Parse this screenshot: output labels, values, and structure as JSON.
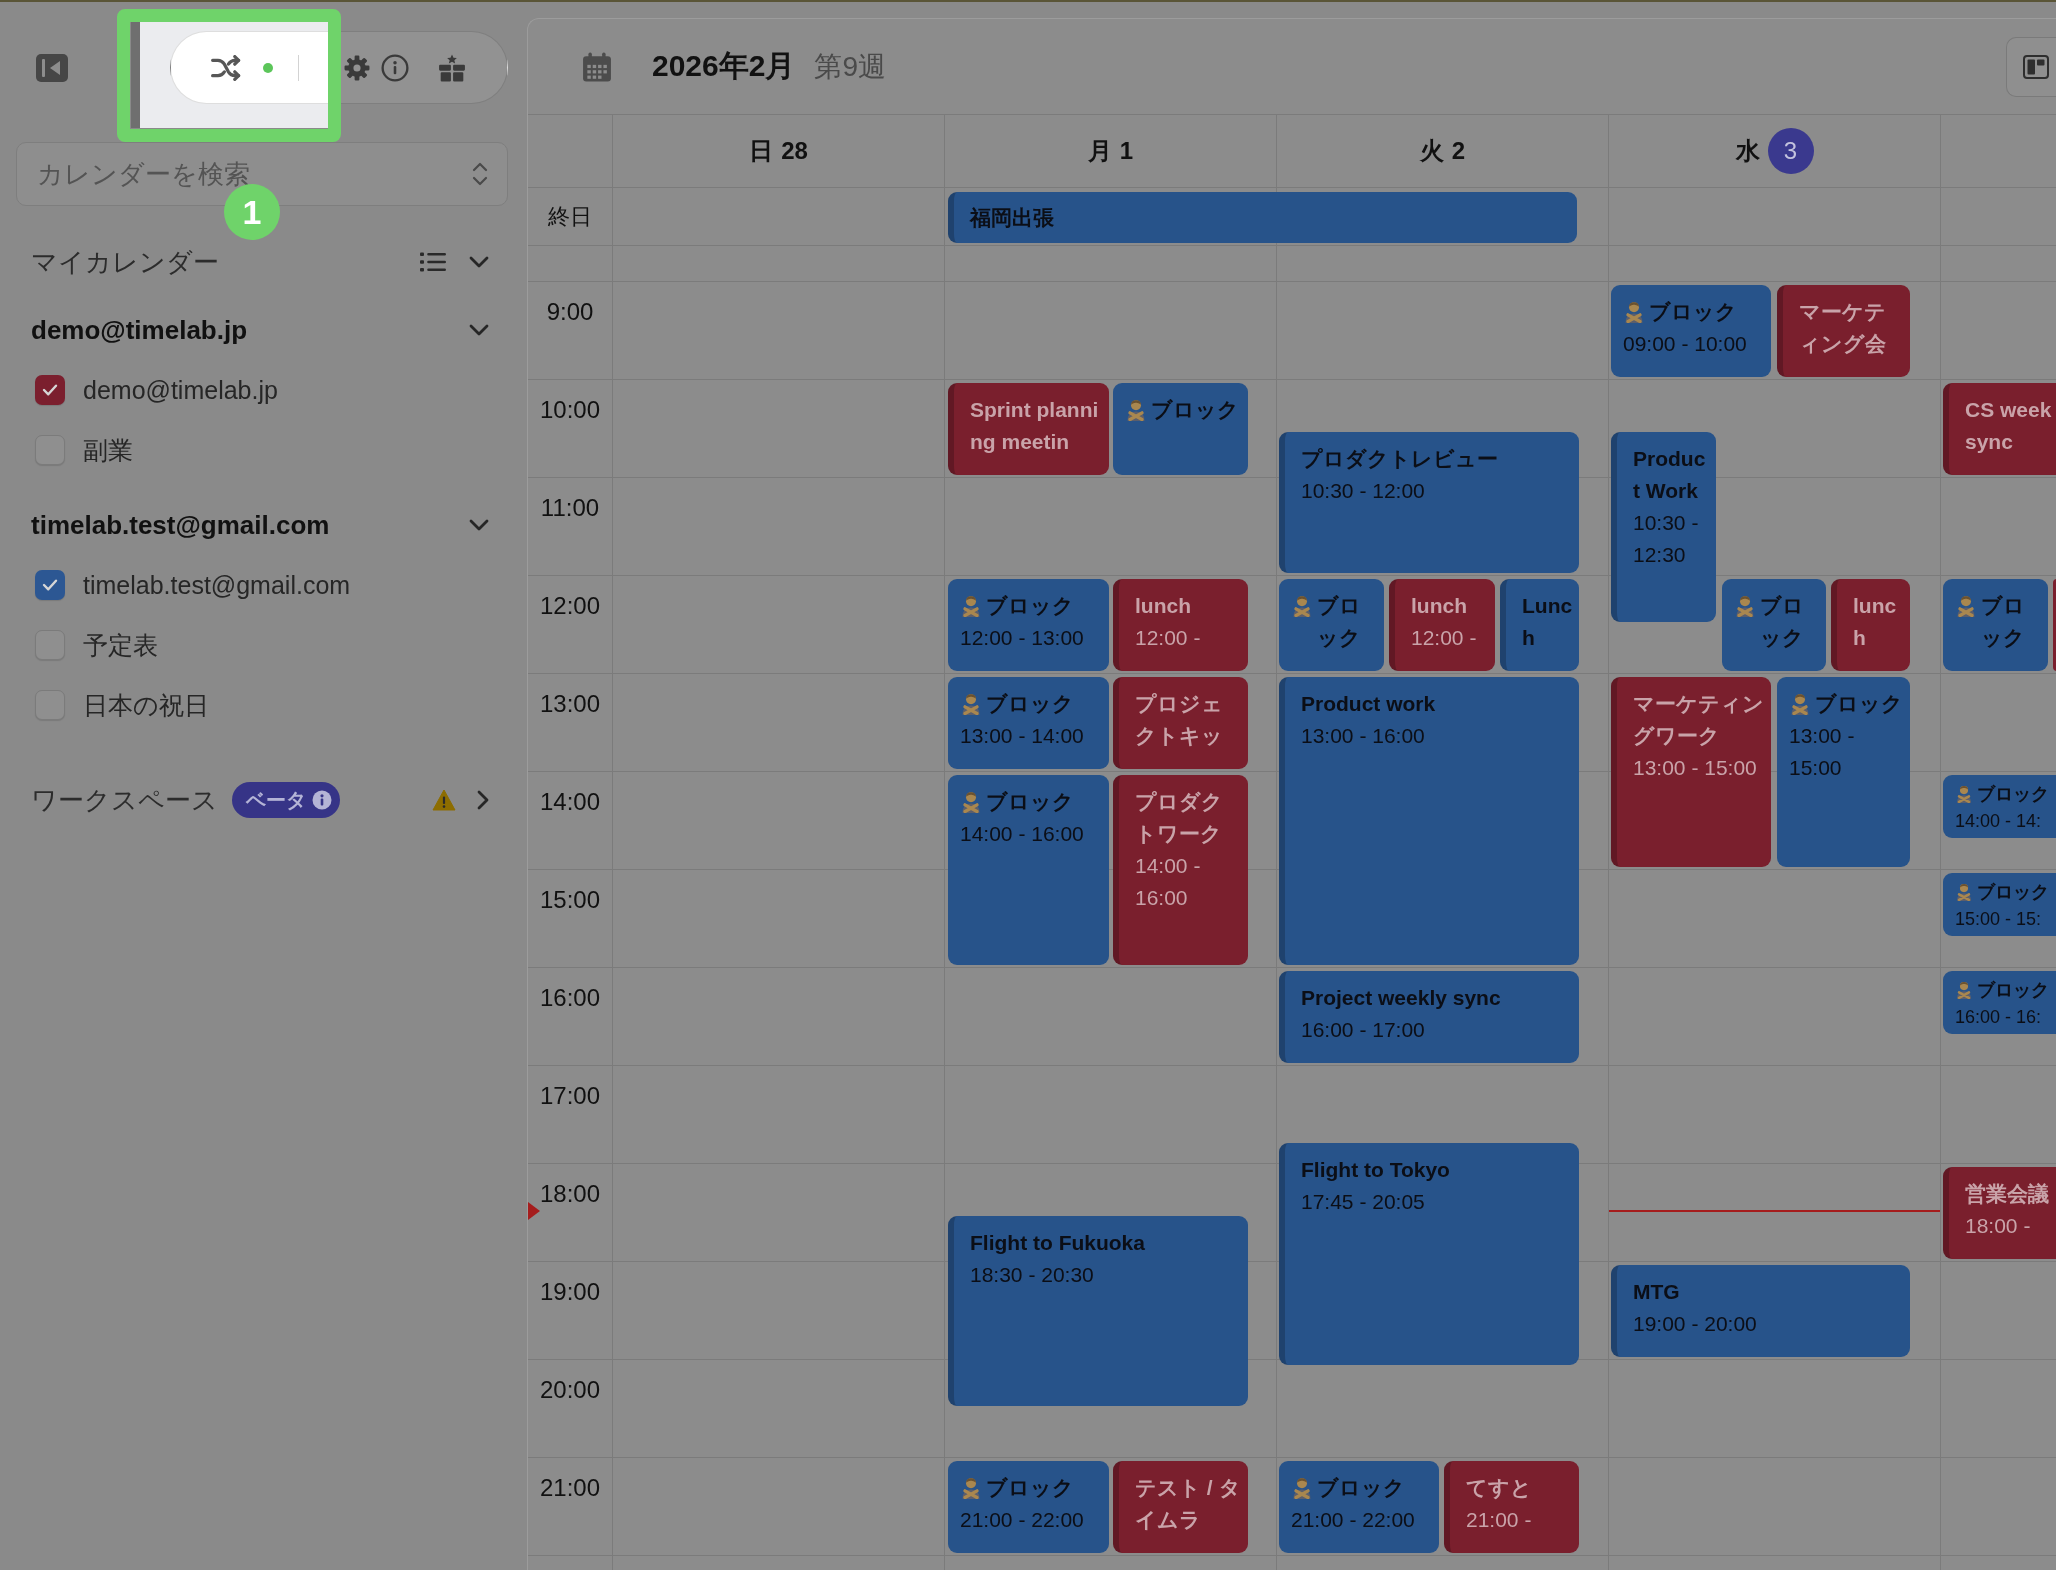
{
  "sidebar": {
    "search": {
      "placeholder": "カレンダーを検索"
    },
    "my_calendars": {
      "title": "マイカレンダー",
      "expanded": true,
      "accounts": [
        {
          "name": "demo@timelab.jp",
          "expanded": true,
          "calendars": [
            {
              "name": "demo@timelab.jp",
              "checked": true,
              "color": "#7b1f2e"
            },
            {
              "name": "副業",
              "checked": false
            }
          ]
        },
        {
          "name": "timelab.test@gmail.com",
          "expanded": true,
          "calendars": [
            {
              "name": "timelab.test@gmail.com",
              "checked": true,
              "color": "#2c5793"
            },
            {
              "name": "予定表",
              "checked": false
            },
            {
              "name": "日本の祝日",
              "checked": false
            }
          ]
        }
      ]
    },
    "workspace": {
      "title": "ワークスペース",
      "badge": "ベータ",
      "expanded": false
    }
  },
  "tutorial": {
    "step": "1"
  },
  "calendar": {
    "title": "2026年2月",
    "week": "第9週",
    "all_day_label": "終日",
    "all_day_events": [
      {
        "title": "福岡出張",
        "color": "#27538a"
      }
    ],
    "hours": [
      "9:00",
      "10:00",
      "11:00",
      "12:00",
      "13:00",
      "14:00",
      "15:00",
      "16:00",
      "17:00",
      "18:00",
      "19:00",
      "20:00",
      "21:00"
    ],
    "days": [
      {
        "weekday": "日",
        "date": "28",
        "today": false
      },
      {
        "weekday": "月",
        "date": "1",
        "today": false,
        "events": [
          {
            "kind": "event",
            "title": "Sprint planning meetin",
            "color": "#7a1f2d"
          },
          {
            "kind": "block",
            "title": "ブロック",
            "color": "#27538a"
          },
          {
            "kind": "block",
            "title": "ブロック",
            "time": "12:00 - 13:00",
            "color": "#27538a"
          },
          {
            "kind": "event",
            "title": "lunch",
            "time": "12:00 -",
            "color": "#7a1f2d"
          },
          {
            "kind": "block",
            "title": "ブロック",
            "time": "13:00 - 14:00",
            "color": "#27538a"
          },
          {
            "kind": "event",
            "title": "プロジェクトキッ",
            "color": "#7a1f2d"
          },
          {
            "kind": "block",
            "title": "ブロック",
            "time": "14:00 - 16:00",
            "color": "#27538a"
          },
          {
            "kind": "event",
            "title": "プロダクトワーク",
            "time": "14:00 - 16:00",
            "color": "#7a1f2d"
          },
          {
            "kind": "event",
            "title": "Flight to Fukuoka",
            "time": "18:30 - 20:30",
            "color": "#27538a"
          },
          {
            "kind": "block",
            "title": "ブロック",
            "time": "21:00 - 22:00",
            "color": "#27538a"
          },
          {
            "kind": "event",
            "title": "テスト / タイムラ",
            "color": "#7a1f2d"
          }
        ]
      },
      {
        "weekday": "火",
        "date": "2",
        "today": false,
        "events": [
          {
            "kind": "event",
            "title": "プロダクトレビュー",
            "time": "10:30 - 12:00",
            "color": "#27538a"
          },
          {
            "kind": "block",
            "title": "ブロック",
            "color": "#27538a"
          },
          {
            "kind": "event",
            "title": "lunch",
            "time": "12:00 -",
            "color": "#7a1f2d"
          },
          {
            "kind": "event",
            "title": "Lunch",
            "color": "#27538a"
          },
          {
            "kind": "event",
            "title": "Product work",
            "time": "13:00 - 16:00",
            "color": "#27538a"
          },
          {
            "kind": "event",
            "title": "Project weekly sync",
            "time": "16:00 - 17:00",
            "color": "#27538a"
          },
          {
            "kind": "event",
            "title": "Flight to Tokyo",
            "time": "17:45 - 20:05",
            "color": "#27538a"
          },
          {
            "kind": "block",
            "title": "ブロック",
            "time": "21:00 - 22:00",
            "color": "#27538a"
          },
          {
            "kind": "event",
            "title": "てすと",
            "time": "21:00 -",
            "color": "#7a1f2d"
          }
        ]
      },
      {
        "weekday": "水",
        "date": "3",
        "today": true,
        "events": [
          {
            "kind": "block",
            "title": "ブロック",
            "time": "09:00 - 10:00",
            "color": "#27538a"
          },
          {
            "kind": "event",
            "title": "マーケティング会",
            "color": "#7a1f2d"
          },
          {
            "kind": "event",
            "title": "Product Work",
            "time": "10:30 - 12:30",
            "color": "#27538a"
          },
          {
            "kind": "block",
            "title": "ブロック",
            "color": "#27538a"
          },
          {
            "kind": "event",
            "title": "lunch",
            "color": "#7a1f2d"
          },
          {
            "kind": "event",
            "title": "マーケティングワーク",
            "time": "13:00 - 15:00",
            "color": "#7a1f2d"
          },
          {
            "kind": "block",
            "title": "ブロック",
            "time": "13:00 - 15:00",
            "color": "#27538a"
          },
          {
            "kind": "event",
            "title": "MTG",
            "time": "19:00 - 20:00",
            "color": "#27538a"
          }
        ]
      },
      {
        "events": [
          {
            "kind": "event",
            "title": "CS week sync",
            "color": "#7a1f2d"
          },
          {
            "kind": "block",
            "title": "ブロック",
            "color": "#27538a"
          },
          {
            "kind": "event",
            "color": "#7a1f2d"
          },
          {
            "kind": "block",
            "title": "ブロック",
            "time": "14:00 - 14:",
            "color": "#27538a"
          },
          {
            "kind": "block",
            "title": "ブロック",
            "time": "15:00 - 15:",
            "color": "#27538a"
          },
          {
            "kind": "block",
            "title": "ブロック",
            "time": "16:00 - 16:",
            "color": "#27538a"
          },
          {
            "kind": "event",
            "title": "営業会議",
            "time": "18:00 -",
            "color": "#7a1f2d"
          }
        ]
      }
    ]
  }
}
